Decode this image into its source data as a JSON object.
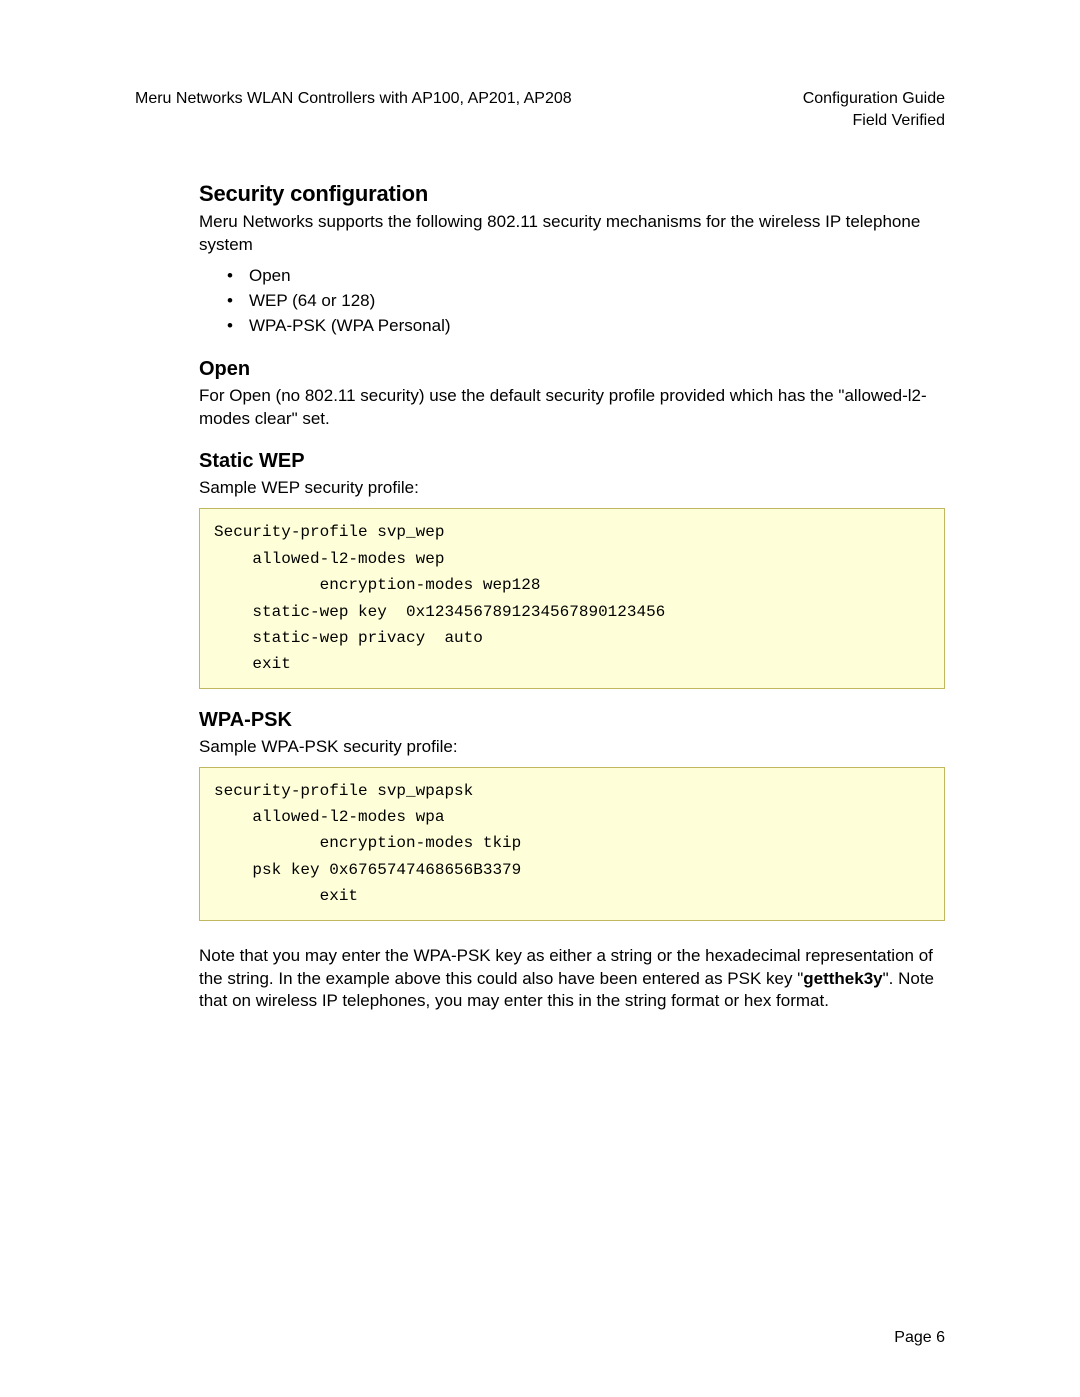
{
  "header": {
    "left": "Meru Networks WLAN Controllers with AP100, AP201, AP208",
    "right_line1": "Configuration Guide",
    "right_line2": "Field Verified"
  },
  "section_title": "Security configuration",
  "intro_text": "Meru Networks supports the following 802.11 security mechanisms for the wireless IP telephone system",
  "bullets": [
    "Open",
    "WEP (64 or 128)",
    "WPA-PSK (WPA Personal)"
  ],
  "open": {
    "title": "Open",
    "text": "For Open (no 802.11 security) use the default security profile provided which has the \"allowed-l2-modes clear\" set."
  },
  "wep": {
    "title": "Static WEP",
    "intro": "Sample WEP security profile:",
    "code": "Security-profile svp_wep\n    allowed-l2-modes wep\n           encryption-modes wep128\n    static-wep key  0x1234567891234567890123456\n    static-wep privacy  auto\n    exit"
  },
  "wpa": {
    "title": "WPA-PSK",
    "intro": "Sample WPA-PSK security profile:",
    "code": "security-profile svp_wpapsk\n    allowed-l2-modes wpa\n           encryption-modes tkip\n    psk key 0x6765747468656B3379\n           exit"
  },
  "note": {
    "part1": "Note that you may enter the WPA-PSK key as either a string or the hexadecimal representation of the string. In the example above this could also have been entered as PSK key \"",
    "bold": "getthek3y",
    "part2": "\". Note that on wireless IP telephones, you may enter this in the string format or hex format."
  },
  "footer": "Page 6"
}
